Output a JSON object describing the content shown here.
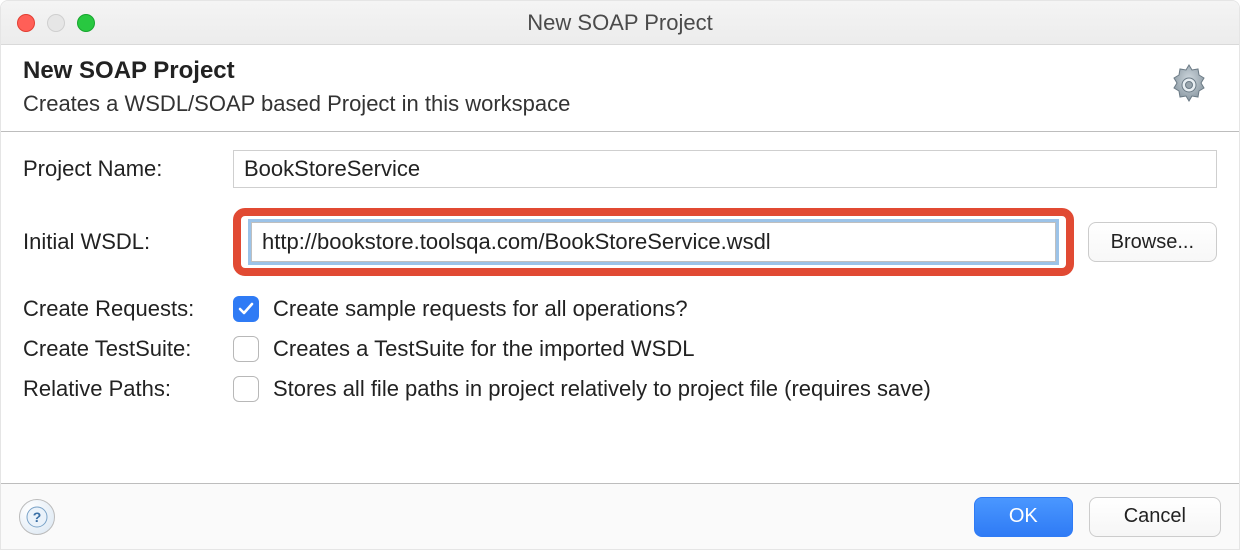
{
  "window": {
    "title": "New SOAP Project"
  },
  "header": {
    "title": "New SOAP Project",
    "subtitle": "Creates a WSDL/SOAP based Project in this workspace"
  },
  "form": {
    "projectName": {
      "label": "Project Name:",
      "value": "BookStoreService"
    },
    "initialWsdl": {
      "label": "Initial WSDL:",
      "value": "http://bookstore.toolsqa.com/BookStoreService.wsdl",
      "browse": "Browse..."
    },
    "createRequests": {
      "label": "Create Requests:",
      "option": "Create sample requests for all operations?",
      "checked": true
    },
    "createTestSuite": {
      "label": "Create TestSuite:",
      "option": "Creates a TestSuite for the imported WSDL",
      "checked": false
    },
    "relativePaths": {
      "label": "Relative Paths:",
      "option": "Stores all file paths in project relatively to project file (requires save)",
      "checked": false
    }
  },
  "footer": {
    "ok": "OK",
    "cancel": "Cancel"
  }
}
